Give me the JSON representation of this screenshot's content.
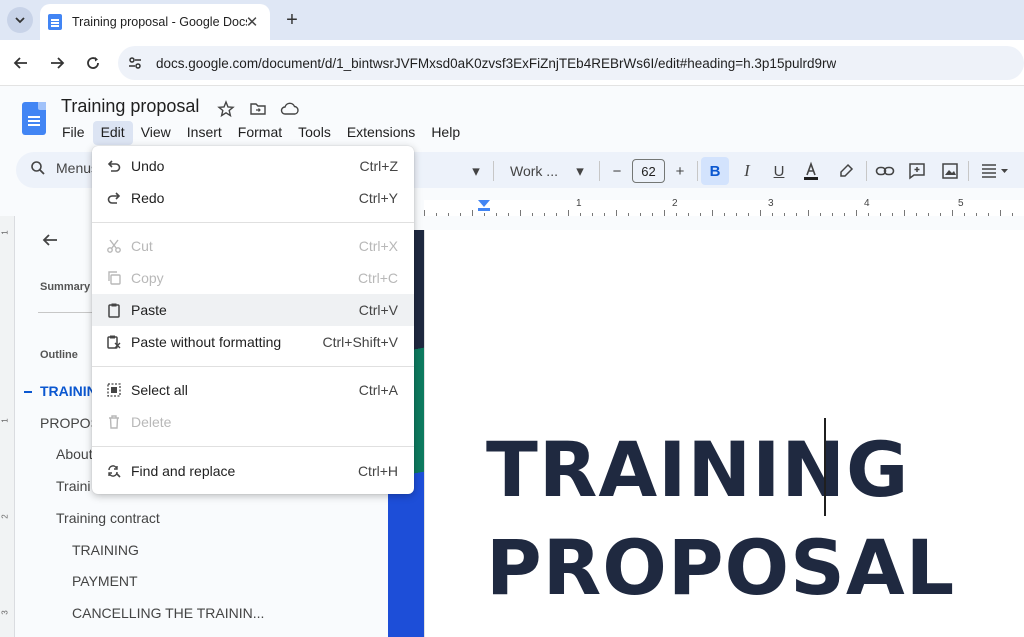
{
  "browser": {
    "tab_title": "Training proposal - Google Docs",
    "url": "docs.google.com/document/d/1_bintwsrJVFMxsd0aK0zvsf3ExFiZnjTEb4REBrWs6I/edit#heading=h.3p15pulrd9rw"
  },
  "doc": {
    "title": "Training proposal",
    "menus": [
      "File",
      "Edit",
      "View",
      "Insert",
      "Format",
      "Tools",
      "Extensions",
      "Help"
    ],
    "active_menu": "Edit"
  },
  "toolbar": {
    "search_label": "Menus",
    "font_name": "Work ...",
    "font_size": "62"
  },
  "edit_menu": {
    "items": [
      {
        "label": "Undo",
        "shortcut": "Ctrl+Z",
        "icon": "undo-icon",
        "enabled": true
      },
      {
        "label": "Redo",
        "shortcut": "Ctrl+Y",
        "icon": "redo-icon",
        "enabled": true
      },
      {
        "label": "Cut",
        "shortcut": "Ctrl+X",
        "icon": "scissors-icon",
        "enabled": false
      },
      {
        "label": "Copy",
        "shortcut": "Ctrl+C",
        "icon": "copy-icon",
        "enabled": false
      },
      {
        "label": "Paste",
        "shortcut": "Ctrl+V",
        "icon": "clipboard-icon",
        "enabled": true,
        "hovered": true
      },
      {
        "label": "Paste without formatting",
        "shortcut": "Ctrl+Shift+V",
        "icon": "clipboard-plain-icon",
        "enabled": true
      },
      {
        "label": "Select all",
        "shortcut": "Ctrl+A",
        "icon": "select-all-icon",
        "enabled": true
      },
      {
        "label": "Delete",
        "shortcut": "",
        "icon": "trash-icon",
        "enabled": false
      },
      {
        "label": "Find and replace",
        "shortcut": "Ctrl+H",
        "icon": "find-replace-icon",
        "enabled": true
      }
    ]
  },
  "outline_panel": {
    "summary_label": "Summary",
    "outline_label": "Outline",
    "items": [
      {
        "text": "TRAININ",
        "level": 1,
        "current": true
      },
      {
        "text": "PROPOS",
        "level": 1
      },
      {
        "text": "About",
        "level": 2
      },
      {
        "text": "Traini",
        "level": 2
      },
      {
        "text": "Training contract",
        "level": 2
      },
      {
        "text": "TRAINING",
        "level": 3
      },
      {
        "text": "PAYMENT",
        "level": 3
      },
      {
        "text": "CANCELLING THE TRAININ...",
        "level": 3
      }
    ]
  },
  "ruler": {
    "numbers": [
      "1",
      "2",
      "3",
      "4",
      "5"
    ],
    "vertical_numbers": [
      "1",
      "1",
      "2",
      "3"
    ]
  },
  "page": {
    "heading_line1": "TRAINING",
    "heading_line2": "PROPOSAL"
  },
  "colors": {
    "accent": "#0b57d0",
    "heading": "#1f2940",
    "toolbar_bg": "#edf2fa",
    "menu_hover": "#eff1f3"
  }
}
